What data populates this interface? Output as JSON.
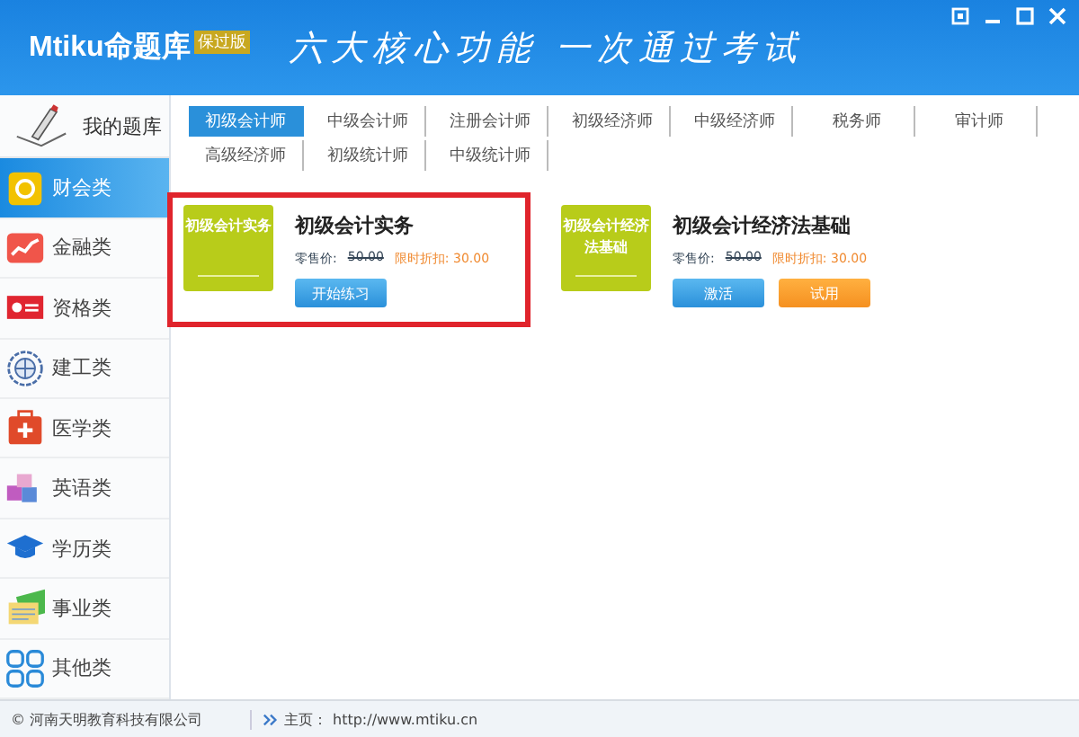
{
  "header": {
    "logo": "Mtiku命题库",
    "edition": "保过版",
    "slogan": "六大核心功能 一次通过考试"
  },
  "sidebar": {
    "home": "我的题库",
    "items": [
      {
        "label": "财会类",
        "selected": true
      },
      {
        "label": "金融类",
        "selected": false
      },
      {
        "label": "资格类",
        "selected": false
      },
      {
        "label": "建工类",
        "selected": false
      },
      {
        "label": "医学类",
        "selected": false
      },
      {
        "label": "英语类",
        "selected": false
      },
      {
        "label": "学历类",
        "selected": false
      },
      {
        "label": "事业类",
        "selected": false
      },
      {
        "label": "其他类",
        "selected": false
      }
    ]
  },
  "tabs": [
    {
      "label": "初级会计师",
      "selected": true
    },
    {
      "label": "中级会计师",
      "selected": false
    },
    {
      "label": "注册会计师",
      "selected": false
    },
    {
      "label": "初级经济师",
      "selected": false
    },
    {
      "label": "中级经济师",
      "selected": false
    },
    {
      "label": "税务师",
      "selected": false
    },
    {
      "label": "审计师",
      "selected": false
    },
    {
      "label": "高级经济师",
      "selected": false
    },
    {
      "label": "初级统计师",
      "selected": false
    },
    {
      "label": "中级统计师",
      "selected": false
    }
  ],
  "products": [
    {
      "cover": "初级会计实务",
      "title": "初级会计实务",
      "price_label": "零售价:",
      "price": "50.00",
      "discount": "限时折扣: 30.00",
      "highlighted": true,
      "buttons": [
        {
          "label": "开始练习",
          "kind": "primary"
        }
      ]
    },
    {
      "cover": "初级会计经济法基础",
      "title": "初级会计经济法基础",
      "price_label": "零售价:",
      "price": "50.00",
      "discount": "限时折扣: 30.00",
      "highlighted": false,
      "buttons": [
        {
          "label": "激活",
          "kind": "primary"
        },
        {
          "label": "试用",
          "kind": "trial"
        }
      ]
    }
  ],
  "status_bar": {
    "copyright": "© 河南天明教育科技有限公司",
    "home_label": "主页：",
    "url": "http://www.mtiku.cn"
  }
}
